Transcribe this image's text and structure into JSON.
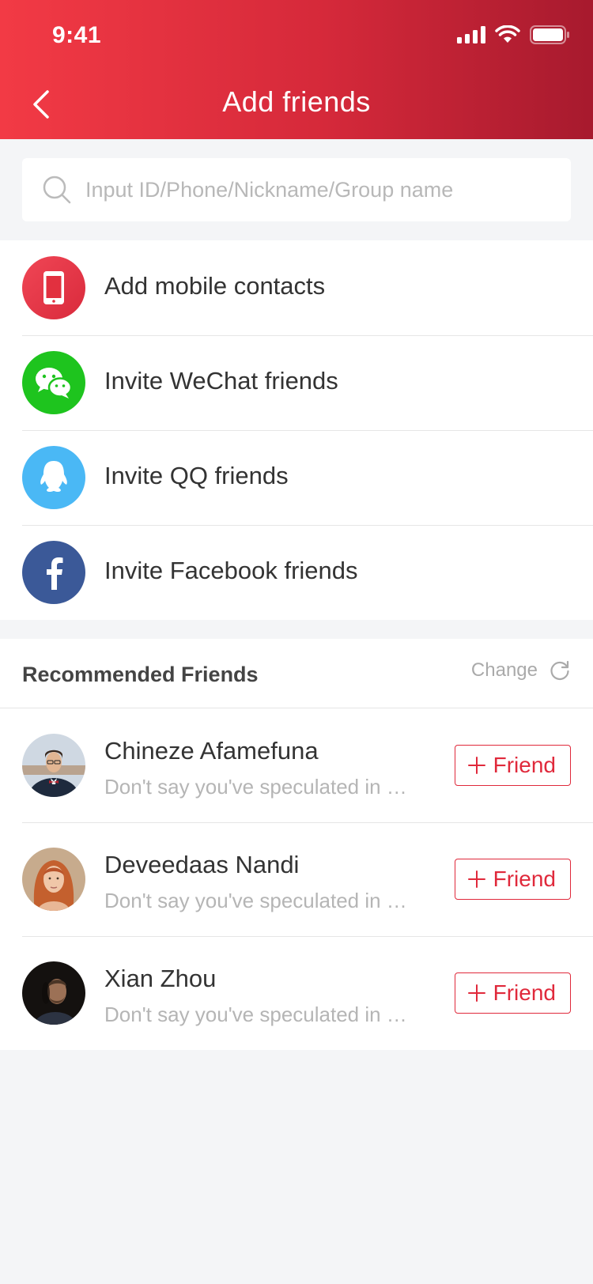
{
  "status_bar": {
    "time": "9:41"
  },
  "header": {
    "title": "Add friends"
  },
  "search": {
    "placeholder": "Input ID/Phone/Nickname/Group name"
  },
  "actions": [
    {
      "label": "Add mobile contacts",
      "icon": "mobile-phone-icon",
      "color": "#e8374a"
    },
    {
      "label": "Invite WeChat friends",
      "icon": "wechat-icon",
      "color": "#1ec41e"
    },
    {
      "label": "Invite QQ friends",
      "icon": "qq-icon",
      "color": "#4ab8f5"
    },
    {
      "label": "Invite Facebook friends",
      "icon": "facebook-icon",
      "color": "#3b5998"
    }
  ],
  "recommended": {
    "title": "Recommended Friends",
    "change_label": "Change",
    "friends": [
      {
        "name": "Chineze Afamefuna",
        "desc": "Don't say you've speculated in …",
        "button": "Friend"
      },
      {
        "name": "Deveedaas Nandi",
        "desc": "Don't say you've speculated in …",
        "button": "Friend"
      },
      {
        "name": "Xian Zhou",
        "desc": "Don't say you've speculated in …",
        "button": "Friend"
      }
    ]
  },
  "colors": {
    "accent": "#e0293b",
    "header_start": "#f23a45",
    "header_end": "#a71a2e"
  }
}
